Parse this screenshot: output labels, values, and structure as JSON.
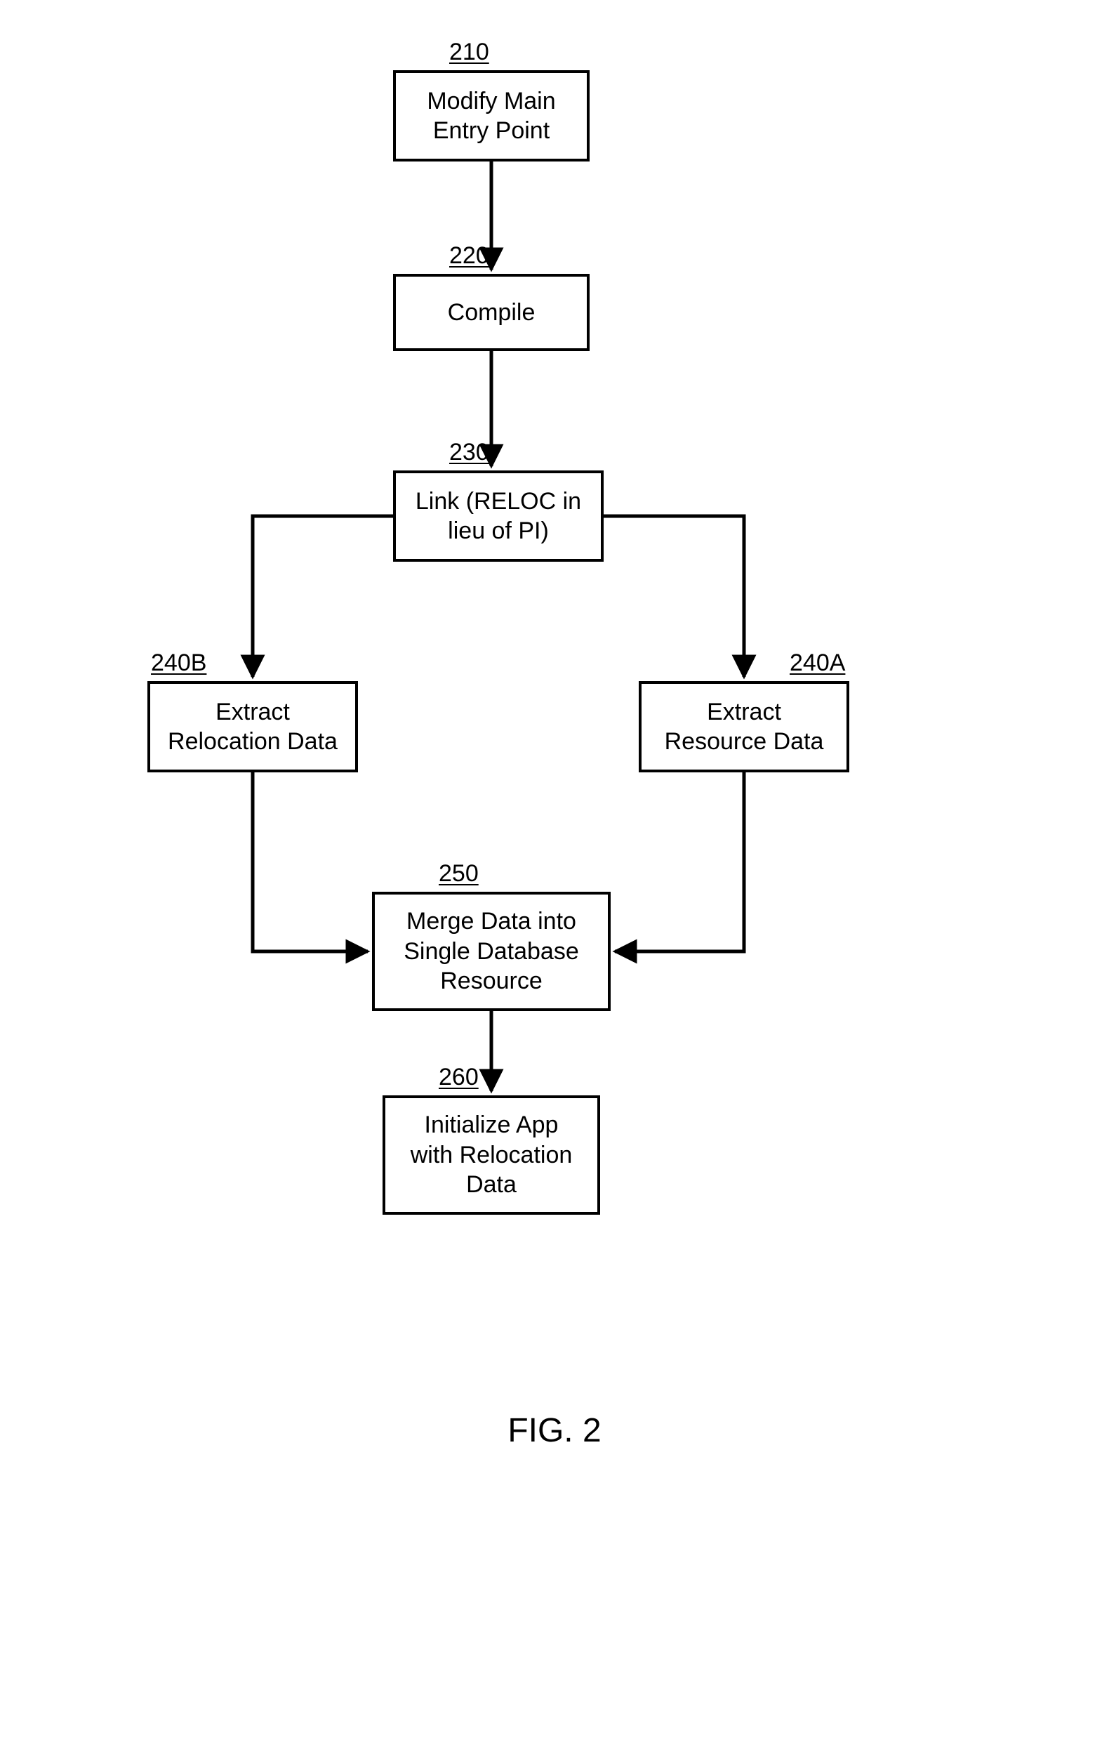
{
  "nodes": {
    "n210": {
      "label": "210",
      "text": "Modify Main\nEntry Point"
    },
    "n220": {
      "label": "220",
      "text": "Compile"
    },
    "n230": {
      "label": "230",
      "text": "Link (RELOC in\nlieu of PI)"
    },
    "n240b": {
      "label": "240B",
      "text": "Extract\nRelocation Data"
    },
    "n240a": {
      "label": "240A",
      "text": "Extract\nResource Data"
    },
    "n250": {
      "label": "250",
      "text": "Merge Data into\nSingle Database\nResource"
    },
    "n260": {
      "label": "260",
      "text": "Initialize  App\nwith Relocation\nData"
    }
  },
  "caption": "FIG. 2"
}
